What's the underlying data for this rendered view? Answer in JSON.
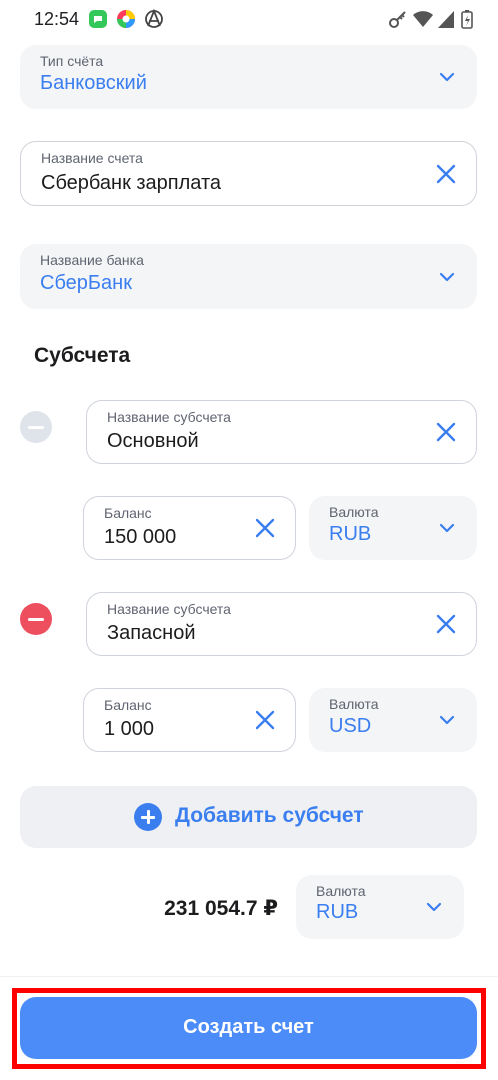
{
  "status_bar": {
    "time": "12:54",
    "left_icons": [
      "chat-app-icon",
      "color-wheel-app-icon",
      "anarchy-symbol-icon"
    ],
    "right_icons": [
      "key-icon",
      "wifi-icon",
      "signal-icon",
      "battery-icon"
    ]
  },
  "account_type": {
    "label": "Тип счёта",
    "value": "Банковский"
  },
  "account_name": {
    "label": "Название счета",
    "value": "Сбербанк зарплата"
  },
  "bank_name": {
    "label": "Название банка",
    "value": "СберБанк"
  },
  "subaccounts_title": "Субсчета",
  "subaccounts": [
    {
      "name_label": "Название субсчета",
      "name": "Основной",
      "balance_label": "Баланс",
      "balance": "150 000",
      "currency_label": "Валюта",
      "currency": "RUB",
      "remove_enabled": false
    },
    {
      "name_label": "Название субсчета",
      "name": "Запасной",
      "balance_label": "Баланс",
      "balance": "1 000",
      "currency_label": "Валюта",
      "currency": "USD",
      "remove_enabled": true
    }
  ],
  "add_subaccount_label": "Добавить субсчет",
  "total": {
    "amount": "231 054.7 ₽",
    "currency_label": "Валюта",
    "currency": "RUB"
  },
  "create_button_label": "Создать счет",
  "colors": {
    "accent": "#3a7ef0",
    "button": "#4c8cf8",
    "remove_active": "#ee4f5f",
    "remove_disabled": "#dfe3ea",
    "highlight": "#ff0000"
  }
}
